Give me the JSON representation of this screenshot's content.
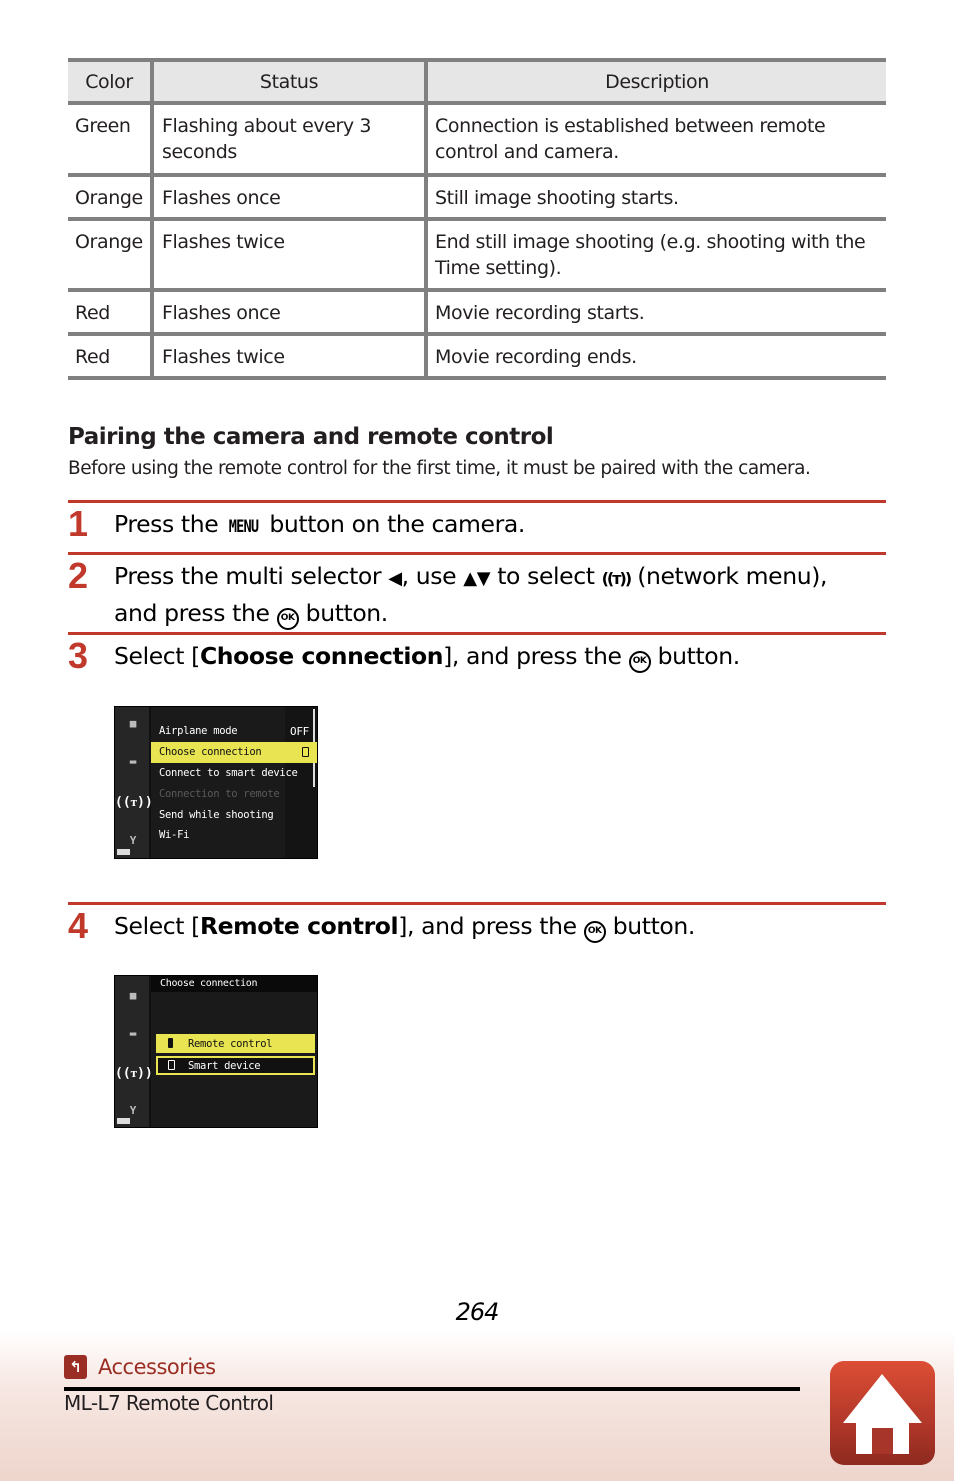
{
  "table": {
    "headers": [
      "Color",
      "Status",
      "Description"
    ],
    "rows": [
      {
        "color": "Green",
        "status": "Flashing about every 3 seconds",
        "description": "Connection is established between remote control and camera."
      },
      {
        "color": "Orange",
        "status": "Flashes once",
        "description": "Still image shooting starts."
      },
      {
        "color": "Orange",
        "status": "Flashes twice",
        "description": "End still image shooting (e.g. shooting with the Time setting)."
      },
      {
        "color": "Red",
        "status": "Flashes once",
        "description": "Movie recording starts."
      },
      {
        "color": "Red",
        "status": "Flashes twice",
        "description": "Movie recording ends."
      }
    ]
  },
  "section": {
    "title": "Pairing the camera and remote control",
    "intro": "Before using the remote control for the first time, it must be paired with the camera."
  },
  "steps": [
    {
      "number": "1",
      "pre": "Press the ",
      "menu_glyph": "MENU",
      "post": " button on the camera."
    },
    {
      "number": "2",
      "line1_a": "Press the multi selector ",
      "left_tri": "◀",
      "line1_b": ", use ",
      "updown": "▲▼",
      "line1_c": " to select ",
      "net_glyph": "((ᴛ))",
      "line1_d": " (network menu),",
      "line2_a": "and press the ",
      "ok": "OK",
      "line2_b": " button."
    },
    {
      "number": "3",
      "pre": "Select [",
      "bold": "Choose connection",
      "post": "], and press the ",
      "ok": "OK",
      "end": " button."
    },
    {
      "number": "4",
      "pre": "Select [",
      "bold": "Remote control",
      "post": "], and press the ",
      "ok": "OK",
      "end": " button."
    }
  ],
  "screen1": {
    "items": [
      {
        "label": "Airplane mode",
        "value": "OFF",
        "state": "normal"
      },
      {
        "label": "Choose connection",
        "value": "",
        "state": "selected"
      },
      {
        "label": "Connect to smart device",
        "value": "",
        "state": "normal"
      },
      {
        "label": "Connection to remote",
        "value": "",
        "state": "disabled"
      },
      {
        "label": "Send while shooting",
        "value": "",
        "state": "normal"
      },
      {
        "label": "Wi-Fi",
        "value": "",
        "state": "normal"
      }
    ],
    "side_icons": [
      "camera-icon",
      "movie-icon",
      "network-icon",
      "wrench-icon",
      "battery-icon"
    ]
  },
  "screen2": {
    "title": "Choose connection",
    "options": [
      {
        "label": "Remote control",
        "icon": "remote-icon",
        "selected": true
      },
      {
        "label": "Smart device",
        "icon": "phone-icon",
        "selected": false
      }
    ]
  },
  "footer": {
    "page_number": "264",
    "breadcrumb": "Accessories",
    "subtitle": "ML-L7 Remote Control",
    "back_icon_glyph": "↰"
  },
  "colors": {
    "accent_red": "#c0392b",
    "breadcrumb": "#9b2e24",
    "menu_highlight": "#e8e452",
    "table_rule": "#808080",
    "table_header_bg": "#e6e6e6"
  }
}
